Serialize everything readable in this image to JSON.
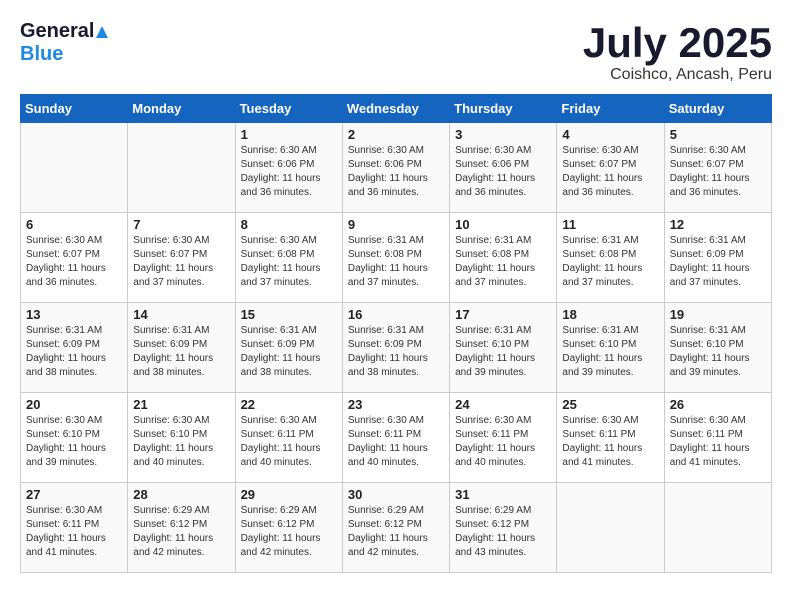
{
  "header": {
    "logo_general": "General",
    "logo_blue": "Blue",
    "title": "July 2025",
    "subtitle": "Coishco, Ancash, Peru"
  },
  "days_of_week": [
    "Sunday",
    "Monday",
    "Tuesday",
    "Wednesday",
    "Thursday",
    "Friday",
    "Saturday"
  ],
  "weeks": [
    [
      {
        "day": "",
        "info": ""
      },
      {
        "day": "",
        "info": ""
      },
      {
        "day": "1",
        "info": "Sunrise: 6:30 AM\nSunset: 6:06 PM\nDaylight: 11 hours and 36 minutes."
      },
      {
        "day": "2",
        "info": "Sunrise: 6:30 AM\nSunset: 6:06 PM\nDaylight: 11 hours and 36 minutes."
      },
      {
        "day": "3",
        "info": "Sunrise: 6:30 AM\nSunset: 6:06 PM\nDaylight: 11 hours and 36 minutes."
      },
      {
        "day": "4",
        "info": "Sunrise: 6:30 AM\nSunset: 6:07 PM\nDaylight: 11 hours and 36 minutes."
      },
      {
        "day": "5",
        "info": "Sunrise: 6:30 AM\nSunset: 6:07 PM\nDaylight: 11 hours and 36 minutes."
      }
    ],
    [
      {
        "day": "6",
        "info": "Sunrise: 6:30 AM\nSunset: 6:07 PM\nDaylight: 11 hours and 36 minutes."
      },
      {
        "day": "7",
        "info": "Sunrise: 6:30 AM\nSunset: 6:07 PM\nDaylight: 11 hours and 37 minutes."
      },
      {
        "day": "8",
        "info": "Sunrise: 6:30 AM\nSunset: 6:08 PM\nDaylight: 11 hours and 37 minutes."
      },
      {
        "day": "9",
        "info": "Sunrise: 6:31 AM\nSunset: 6:08 PM\nDaylight: 11 hours and 37 minutes."
      },
      {
        "day": "10",
        "info": "Sunrise: 6:31 AM\nSunset: 6:08 PM\nDaylight: 11 hours and 37 minutes."
      },
      {
        "day": "11",
        "info": "Sunrise: 6:31 AM\nSunset: 6:08 PM\nDaylight: 11 hours and 37 minutes."
      },
      {
        "day": "12",
        "info": "Sunrise: 6:31 AM\nSunset: 6:09 PM\nDaylight: 11 hours and 37 minutes."
      }
    ],
    [
      {
        "day": "13",
        "info": "Sunrise: 6:31 AM\nSunset: 6:09 PM\nDaylight: 11 hours and 38 minutes."
      },
      {
        "day": "14",
        "info": "Sunrise: 6:31 AM\nSunset: 6:09 PM\nDaylight: 11 hours and 38 minutes."
      },
      {
        "day": "15",
        "info": "Sunrise: 6:31 AM\nSunset: 6:09 PM\nDaylight: 11 hours and 38 minutes."
      },
      {
        "day": "16",
        "info": "Sunrise: 6:31 AM\nSunset: 6:09 PM\nDaylight: 11 hours and 38 minutes."
      },
      {
        "day": "17",
        "info": "Sunrise: 6:31 AM\nSunset: 6:10 PM\nDaylight: 11 hours and 39 minutes."
      },
      {
        "day": "18",
        "info": "Sunrise: 6:31 AM\nSunset: 6:10 PM\nDaylight: 11 hours and 39 minutes."
      },
      {
        "day": "19",
        "info": "Sunrise: 6:31 AM\nSunset: 6:10 PM\nDaylight: 11 hours and 39 minutes."
      }
    ],
    [
      {
        "day": "20",
        "info": "Sunrise: 6:30 AM\nSunset: 6:10 PM\nDaylight: 11 hours and 39 minutes."
      },
      {
        "day": "21",
        "info": "Sunrise: 6:30 AM\nSunset: 6:10 PM\nDaylight: 11 hours and 40 minutes."
      },
      {
        "day": "22",
        "info": "Sunrise: 6:30 AM\nSunset: 6:11 PM\nDaylight: 11 hours and 40 minutes."
      },
      {
        "day": "23",
        "info": "Sunrise: 6:30 AM\nSunset: 6:11 PM\nDaylight: 11 hours and 40 minutes."
      },
      {
        "day": "24",
        "info": "Sunrise: 6:30 AM\nSunset: 6:11 PM\nDaylight: 11 hours and 40 minutes."
      },
      {
        "day": "25",
        "info": "Sunrise: 6:30 AM\nSunset: 6:11 PM\nDaylight: 11 hours and 41 minutes."
      },
      {
        "day": "26",
        "info": "Sunrise: 6:30 AM\nSunset: 6:11 PM\nDaylight: 11 hours and 41 minutes."
      }
    ],
    [
      {
        "day": "27",
        "info": "Sunrise: 6:30 AM\nSunset: 6:11 PM\nDaylight: 11 hours and 41 minutes."
      },
      {
        "day": "28",
        "info": "Sunrise: 6:29 AM\nSunset: 6:12 PM\nDaylight: 11 hours and 42 minutes."
      },
      {
        "day": "29",
        "info": "Sunrise: 6:29 AM\nSunset: 6:12 PM\nDaylight: 11 hours and 42 minutes."
      },
      {
        "day": "30",
        "info": "Sunrise: 6:29 AM\nSunset: 6:12 PM\nDaylight: 11 hours and 42 minutes."
      },
      {
        "day": "31",
        "info": "Sunrise: 6:29 AM\nSunset: 6:12 PM\nDaylight: 11 hours and 43 minutes."
      },
      {
        "day": "",
        "info": ""
      },
      {
        "day": "",
        "info": ""
      }
    ]
  ]
}
